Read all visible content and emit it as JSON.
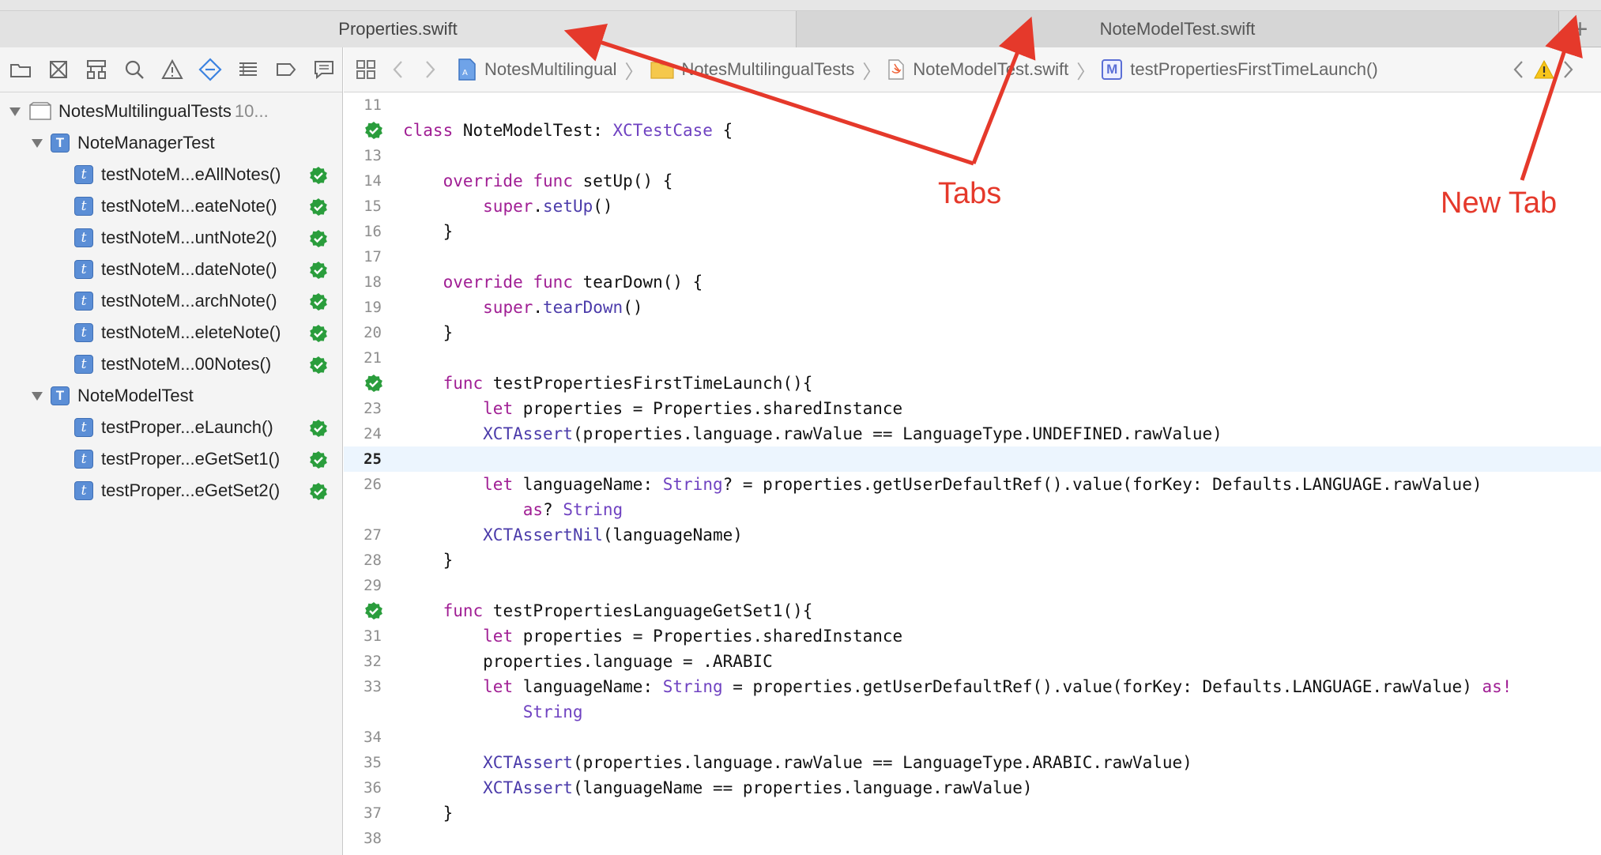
{
  "tabs": [
    {
      "label": "Properties.swift",
      "active": true
    },
    {
      "label": "NoteModelTest.swift",
      "active": false
    }
  ],
  "new_tab_symbol": "+",
  "navigator": {
    "toolbar_icons": [
      "folder-icon",
      "source-control-icon",
      "hierarchy-icon",
      "search-icon",
      "warning-icon",
      "test-diamond-icon",
      "list-icon",
      "breakpoint-icon",
      "report-icon"
    ],
    "root": {
      "label": "NotesMultilingualTests",
      "suffix": "10..."
    },
    "groups": [
      {
        "label": "NoteManagerTest",
        "items": [
          "testNoteM...eAllNotes()",
          "testNoteM...eateNote()",
          "testNoteM...untNote2()",
          "testNoteM...dateNote()",
          "testNoteM...archNote()",
          "testNoteM...eleteNote()",
          "testNoteM...00Notes()"
        ]
      },
      {
        "label": "NoteModelTest",
        "items": [
          "testProper...eLaunch()",
          "testProper...eGetSet1()",
          "testProper...eGetSet2()"
        ]
      }
    ],
    "badge_class": "T",
    "badge_method": "t"
  },
  "jumpbar": {
    "items": [
      "NotesMultilingual",
      "NotesMultilingualTests",
      "NoteModelTest.swift",
      "testPropertiesFirstTimeLaunch()"
    ],
    "method_badge": "M"
  },
  "annotations": {
    "tabs": "Tabs",
    "new_tab": "New Tab"
  },
  "colors": {
    "keyword": "#a01e94",
    "type": "#6f42c1",
    "annotation": "#e5392b",
    "pass": "#2a9d3c",
    "badge": "#5b8ed6"
  },
  "code_lines": [
    {
      "n": "11",
      "segments": [
        {
          "t": ""
        }
      ]
    },
    {
      "n": "",
      "pass": true,
      "segments": [
        {
          "t": "class",
          "c": "kw"
        },
        {
          "t": " NoteModelTest: "
        },
        {
          "t": "XCTestCase",
          "c": "ty"
        },
        {
          "t": " {"
        }
      ]
    },
    {
      "n": "13",
      "segments": [
        {
          "t": ""
        }
      ]
    },
    {
      "n": "14",
      "segments": [
        {
          "t": "    "
        },
        {
          "t": "override",
          "c": "kw"
        },
        {
          "t": " "
        },
        {
          "t": "func",
          "c": "kw"
        },
        {
          "t": " setUp() {"
        }
      ]
    },
    {
      "n": "15",
      "segments": [
        {
          "t": "        "
        },
        {
          "t": "super",
          "c": "kw"
        },
        {
          "t": "."
        },
        {
          "t": "setUp",
          "c": "ty2"
        },
        {
          "t": "()"
        }
      ]
    },
    {
      "n": "16",
      "segments": [
        {
          "t": "    }"
        }
      ]
    },
    {
      "n": "17",
      "segments": [
        {
          "t": ""
        }
      ]
    },
    {
      "n": "18",
      "segments": [
        {
          "t": "    "
        },
        {
          "t": "override",
          "c": "kw"
        },
        {
          "t": " "
        },
        {
          "t": "func",
          "c": "kw"
        },
        {
          "t": " tearDown() {"
        }
      ]
    },
    {
      "n": "19",
      "segments": [
        {
          "t": "        "
        },
        {
          "t": "super",
          "c": "kw"
        },
        {
          "t": "."
        },
        {
          "t": "tearDown",
          "c": "ty2"
        },
        {
          "t": "()"
        }
      ]
    },
    {
      "n": "20",
      "segments": [
        {
          "t": "    }"
        }
      ]
    },
    {
      "n": "21",
      "segments": [
        {
          "t": ""
        }
      ]
    },
    {
      "n": "",
      "pass": true,
      "segments": [
        {
          "t": "    "
        },
        {
          "t": "func",
          "c": "kw"
        },
        {
          "t": " testPropertiesFirstTimeLaunch(){"
        }
      ]
    },
    {
      "n": "23",
      "segments": [
        {
          "t": "        "
        },
        {
          "t": "let",
          "c": "kw"
        },
        {
          "t": " properties = Properties.sharedInstance"
        }
      ]
    },
    {
      "n": "24",
      "segments": [
        {
          "t": "        "
        },
        {
          "t": "XCTAssert",
          "c": "ty2"
        },
        {
          "t": "(properties.language.rawValue == LanguageType.UNDEFINED.rawValue)"
        }
      ]
    },
    {
      "n": "25",
      "current": true,
      "segments": [
        {
          "t": ""
        }
      ]
    },
    {
      "n": "26",
      "segments": [
        {
          "t": "        "
        },
        {
          "t": "let",
          "c": "kw"
        },
        {
          "t": " languageName: "
        },
        {
          "t": "String",
          "c": "ty"
        },
        {
          "t": "? = properties.getUserDefaultRef().value(forKey: Defaults.LANGUAGE.rawValue)"
        }
      ]
    },
    {
      "n": "",
      "segments": [
        {
          "t": "            "
        },
        {
          "t": "as",
          "c": "kw"
        },
        {
          "t": "? "
        },
        {
          "t": "String",
          "c": "ty"
        }
      ]
    },
    {
      "n": "27",
      "segments": [
        {
          "t": "        "
        },
        {
          "t": "XCTAssertNil",
          "c": "ty2"
        },
        {
          "t": "(languageName)"
        }
      ]
    },
    {
      "n": "28",
      "segments": [
        {
          "t": "    }"
        }
      ]
    },
    {
      "n": "29",
      "segments": [
        {
          "t": ""
        }
      ]
    },
    {
      "n": "",
      "pass": true,
      "segments": [
        {
          "t": "    "
        },
        {
          "t": "func",
          "c": "kw"
        },
        {
          "t": " testPropertiesLanguageGetSet1(){"
        }
      ]
    },
    {
      "n": "31",
      "segments": [
        {
          "t": "        "
        },
        {
          "t": "let",
          "c": "kw"
        },
        {
          "t": " properties = Properties.sharedInstance"
        }
      ]
    },
    {
      "n": "32",
      "segments": [
        {
          "t": "        properties.language = .ARABIC"
        }
      ]
    },
    {
      "n": "33",
      "segments": [
        {
          "t": "        "
        },
        {
          "t": "let",
          "c": "kw"
        },
        {
          "t": " languageName: "
        },
        {
          "t": "String",
          "c": "ty"
        },
        {
          "t": " = properties.getUserDefaultRef().value(forKey: Defaults.LANGUAGE.rawValue) "
        },
        {
          "t": "as!",
          "c": "kw"
        }
      ]
    },
    {
      "n": "",
      "segments": [
        {
          "t": "            "
        },
        {
          "t": "String",
          "c": "ty"
        }
      ]
    },
    {
      "n": "34",
      "segments": [
        {
          "t": ""
        }
      ]
    },
    {
      "n": "35",
      "segments": [
        {
          "t": "        "
        },
        {
          "t": "XCTAssert",
          "c": "ty2"
        },
        {
          "t": "(properties.language.rawValue == LanguageType.ARABIC.rawValue)"
        }
      ]
    },
    {
      "n": "36",
      "segments": [
        {
          "t": "        "
        },
        {
          "t": "XCTAssert",
          "c": "ty2"
        },
        {
          "t": "(languageName == properties.language.rawValue)"
        }
      ]
    },
    {
      "n": "37",
      "segments": [
        {
          "t": "    }"
        }
      ]
    },
    {
      "n": "38",
      "segments": [
        {
          "t": ""
        }
      ]
    }
  ]
}
